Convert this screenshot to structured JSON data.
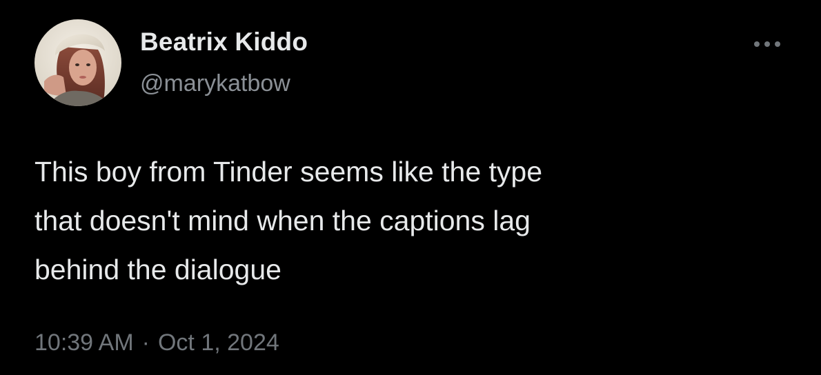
{
  "tweet": {
    "author": {
      "display_name": "Beatrix Kiddo",
      "handle": "@marykatbow"
    },
    "text_lines": [
      "This boy from Tinder seems like the type",
      "that doesn't mind when the captions lag",
      "behind the dialogue"
    ],
    "time": "10:39 AM",
    "separator": "·",
    "date": "Oct 1, 2024",
    "more_icon": "more-horizontal-icon"
  },
  "colors": {
    "background": "#000000",
    "primary_text": "#e7e9ea",
    "secondary_text": "#71767b"
  }
}
